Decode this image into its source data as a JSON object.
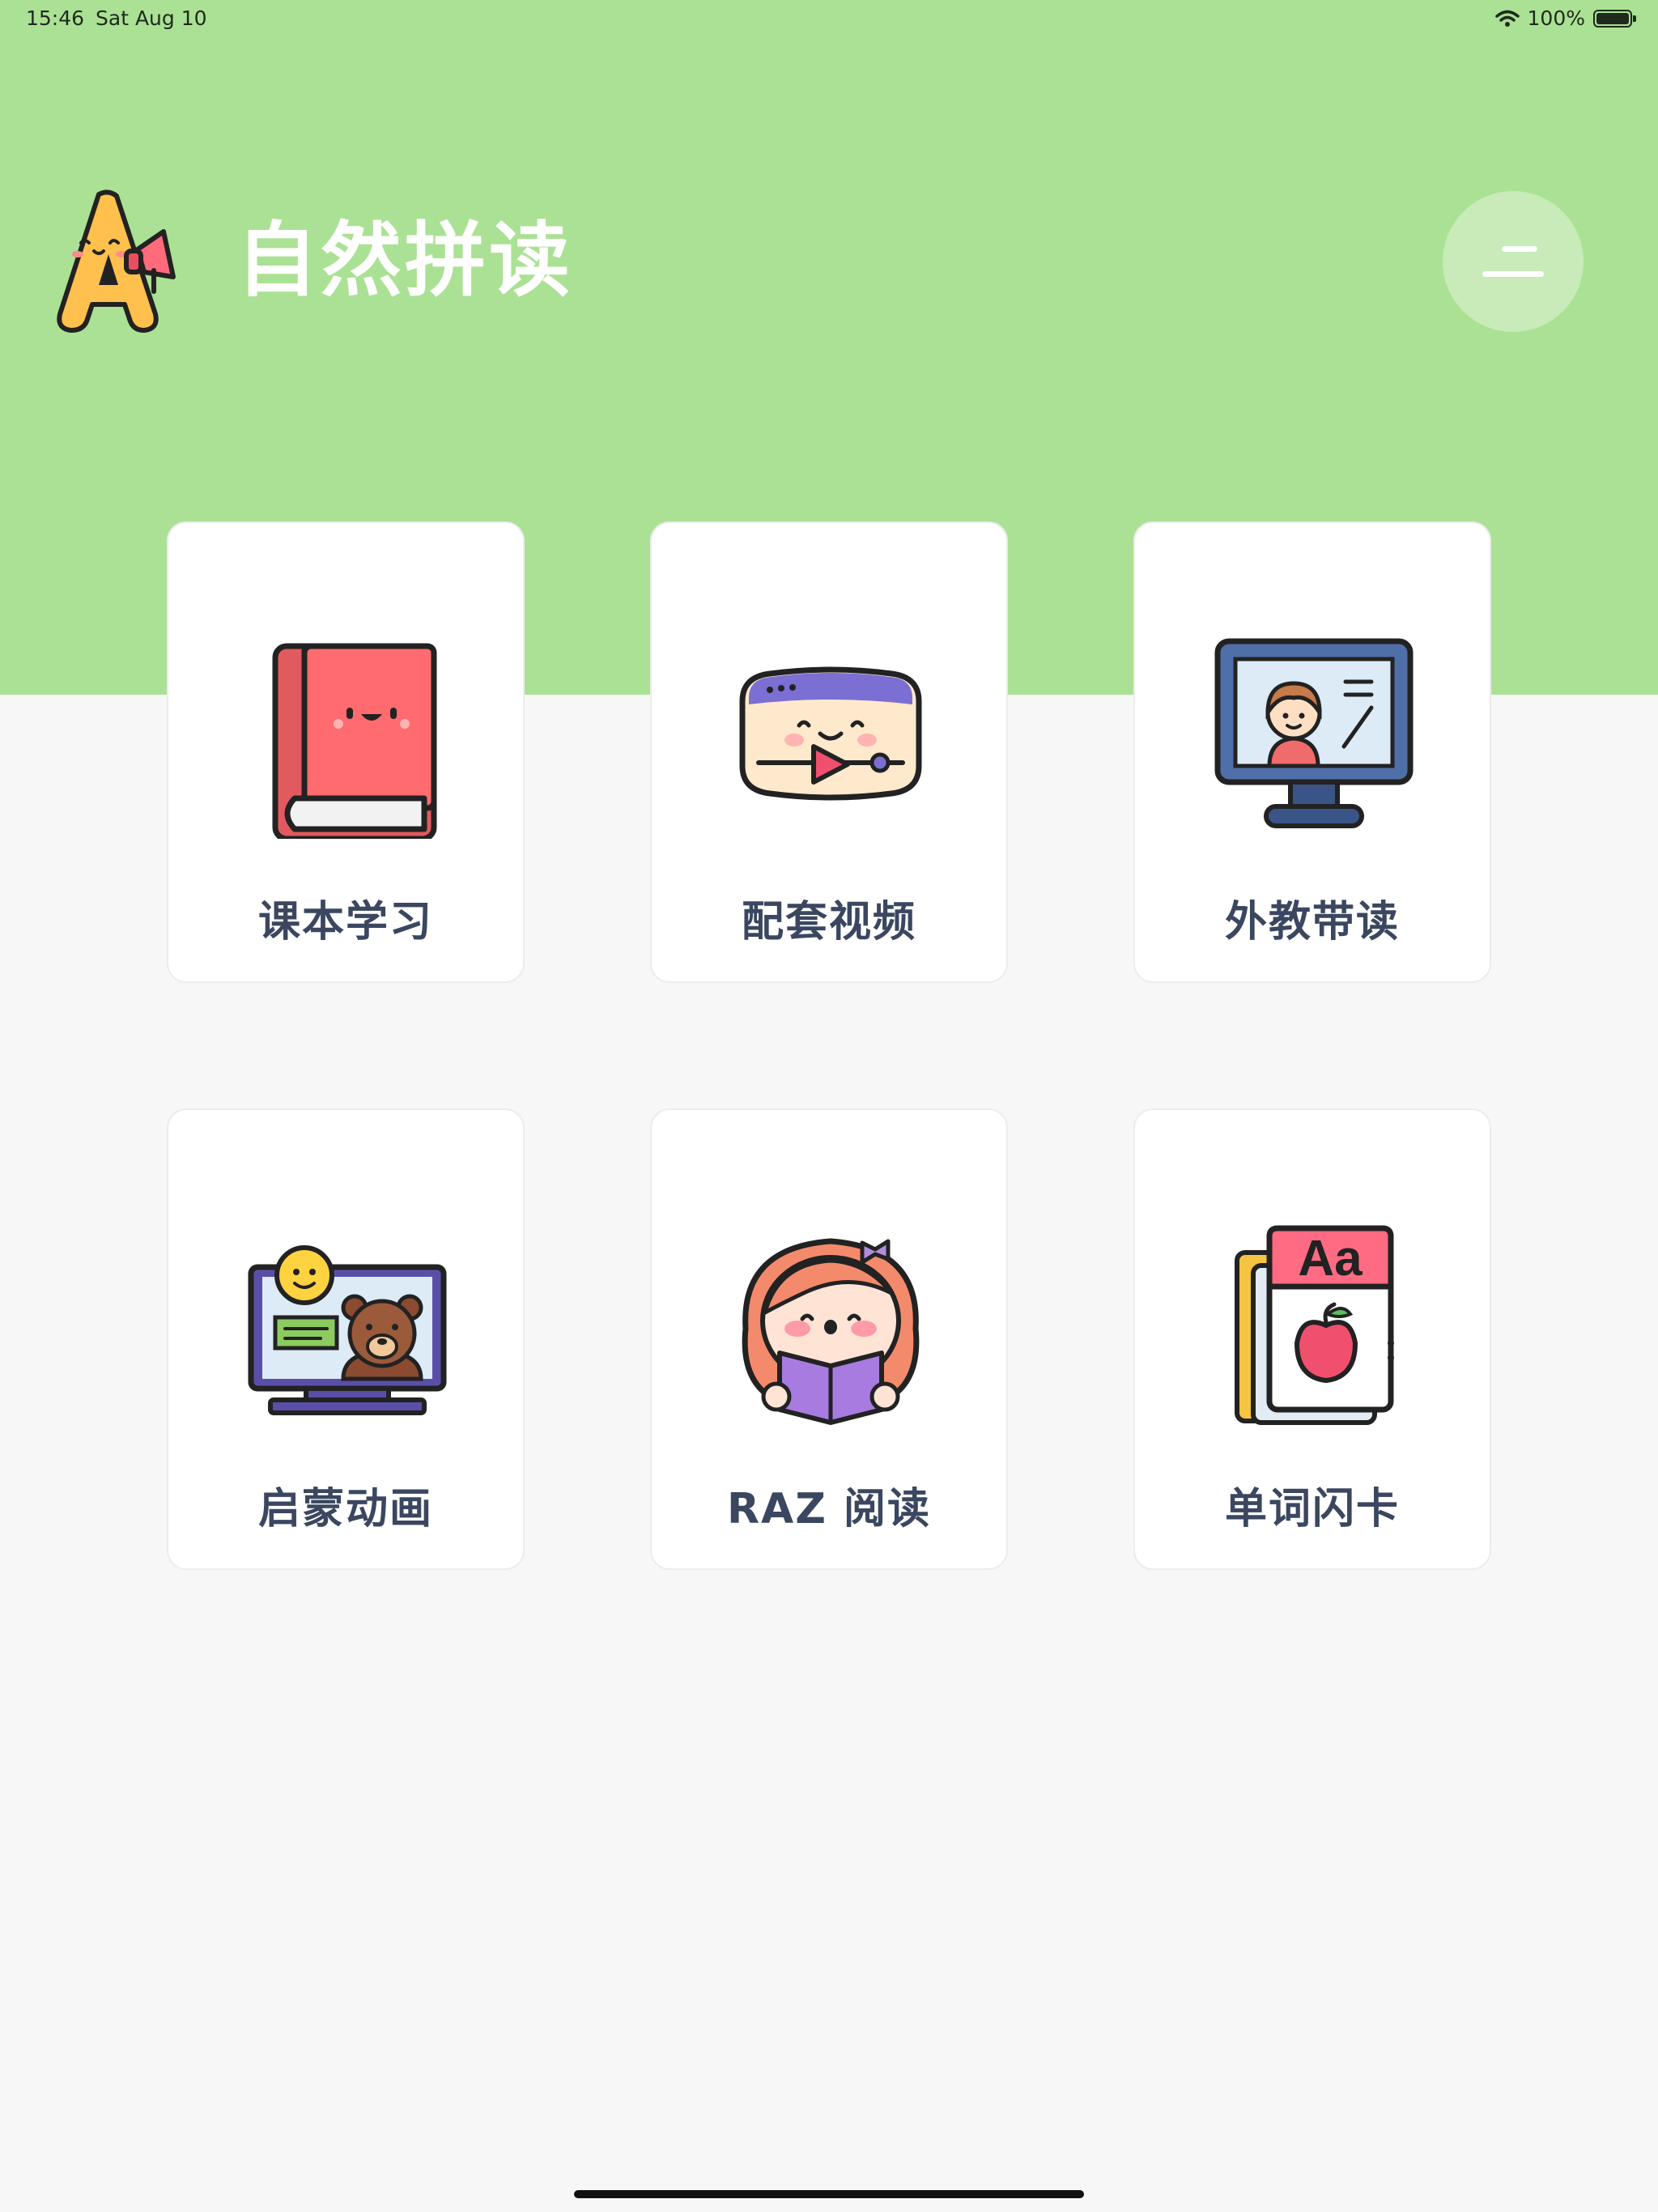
{
  "status_bar": {
    "time": "15:46",
    "date": "Sat Aug 10",
    "battery": "100%"
  },
  "header": {
    "title": "自然拼读",
    "background_color": "#ABE194",
    "logo_icon": "letter-a-megaphone-icon",
    "menu_icon": "menu-icon"
  },
  "cards": [
    {
      "label": "课本学习",
      "icon": "textbook-icon"
    },
    {
      "label": "配套视频",
      "icon": "video-player-icon"
    },
    {
      "label": "外教带读",
      "icon": "online-teacher-icon"
    },
    {
      "label": "启蒙动画",
      "icon": "cartoon-monitor-icon"
    },
    {
      "label": "RAZ 阅读",
      "icon": "girl-reading-icon"
    },
    {
      "label": "单词闪卡",
      "icon": "word-flashcard-icon"
    }
  ],
  "flashcard_text": "Aa"
}
